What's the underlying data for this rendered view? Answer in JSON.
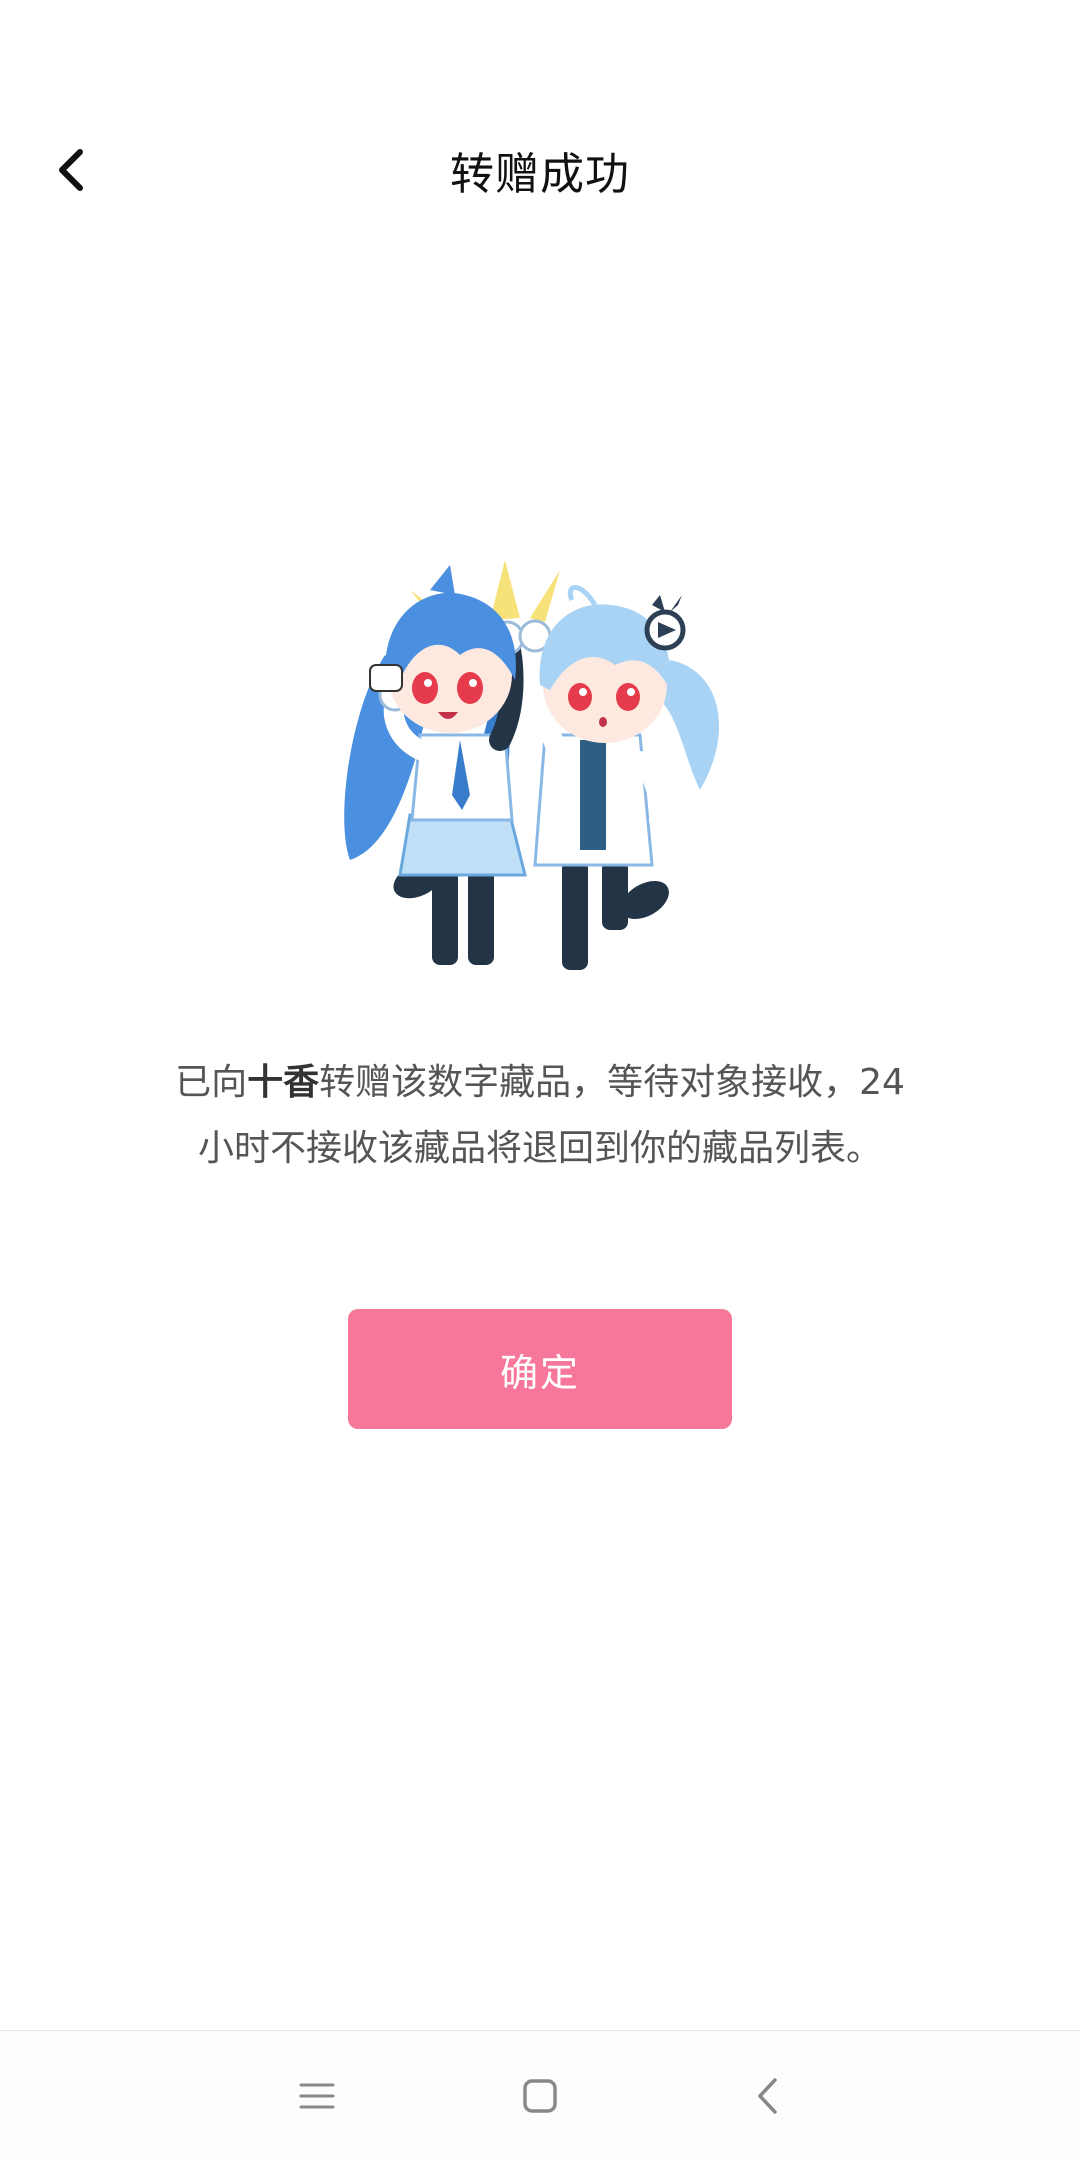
{
  "header": {
    "title": "转赠成功",
    "back_icon": "chevron-left-icon"
  },
  "illustration": {
    "name": "two-chibi-girls-high-five-illustration",
    "colors": {
      "hair_left": "#4a8fe0",
      "hair_right": "#a8d3f5",
      "spark": "#f7e27a",
      "eyes": "#e63b4c",
      "stockings": "#243447"
    }
  },
  "message": {
    "prefix": "已向",
    "recipient": "十香",
    "suffix": "转赠该数字藏品，等待对象接收，24小时不接收该藏品将退回到你的藏品列表。"
  },
  "confirm_button": {
    "label": "确定",
    "color": "#f7779b"
  },
  "navbar": {
    "menu_icon": "menu-lines-icon",
    "home_icon": "home-square-icon",
    "back_icon": "back-chevron-icon"
  }
}
